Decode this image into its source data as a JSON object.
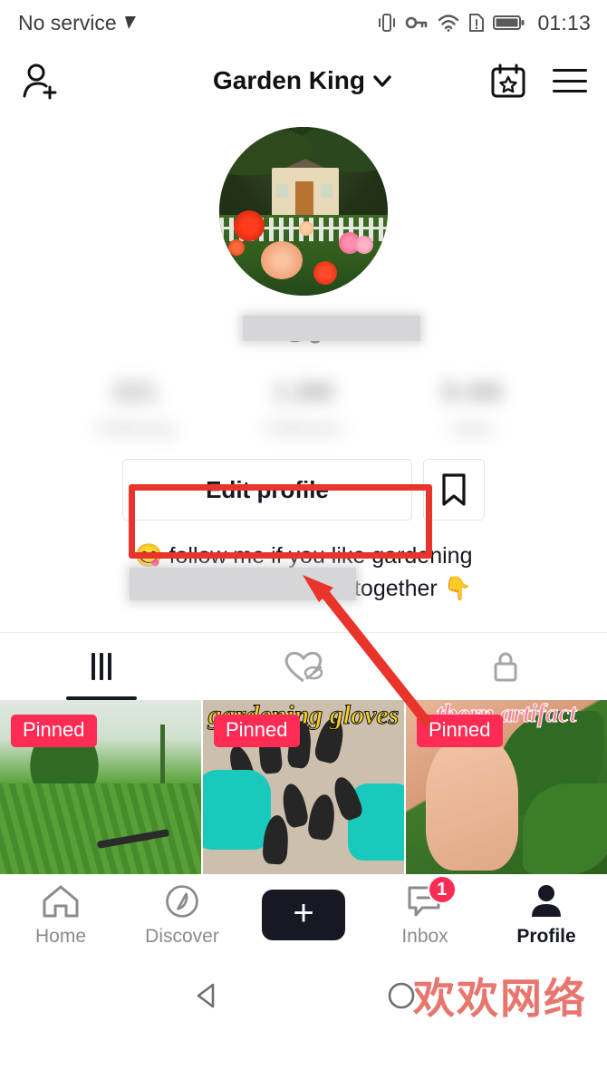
{
  "status_bar": {
    "carrier": "No service",
    "time": "01:13",
    "icons": [
      "signal-off-icon",
      "vibrate-icon",
      "key-icon",
      "wifi-icon",
      "sim-alert-icon",
      "battery-icon"
    ]
  },
  "header": {
    "title": "Garden King",
    "add_friends_icon": "person-add-icon",
    "dropdown_icon": "chevron-down-icon",
    "calendar_icon": "calendar-star-icon",
    "menu_icon": "hamburger-menu-icon"
  },
  "profile": {
    "avatar_alt": "garden-cottage-avatar",
    "username": "@g",
    "username_redacted": true,
    "stats": [
      {
        "value": "221",
        "label": "Following",
        "blurred": true
      },
      {
        "value": "1.8M",
        "label": "Followers",
        "blurred": true
      },
      {
        "value": "9.4M",
        "label": "Likes",
        "blurred": true
      }
    ],
    "edit_button": "Edit profile",
    "bookmark_icon": "bookmark-icon",
    "bio_line1": "😋 follow me if you like gardening",
    "bio_line2": "we can communicate together 👇"
  },
  "tabs": [
    {
      "name": "videos",
      "icon": "grid-icon",
      "active": true
    },
    {
      "name": "liked",
      "icon": "heart-hidden-icon",
      "active": false
    },
    {
      "name": "private",
      "icon": "lock-icon",
      "active": false
    }
  ],
  "videos": [
    {
      "badge": "Pinned",
      "overlay_text": ""
    },
    {
      "badge": "Pinned",
      "overlay_text": "gardening gloves"
    },
    {
      "badge": "Pinned",
      "overlay_text": "thorn artifact"
    }
  ],
  "bottom_nav": [
    {
      "label": "Home",
      "icon": "home-icon",
      "active": false,
      "badge": ""
    },
    {
      "label": "Discover",
      "icon": "compass-icon",
      "active": false,
      "badge": ""
    },
    {
      "label": "",
      "icon": "create-plus-icon",
      "active": false,
      "badge": ""
    },
    {
      "label": "Inbox",
      "icon": "inbox-message-icon",
      "active": false,
      "badge": "1"
    },
    {
      "label": "Profile",
      "icon": "person-icon",
      "active": true,
      "badge": ""
    }
  ],
  "android_nav": {
    "back_icon": "back-triangle-icon",
    "home_icon": "home-circle-icon"
  },
  "watermark": "欢欢网络",
  "annotation": {
    "highlight_target": "edit-profile-button",
    "color": "#e8342b",
    "arrow": "arrow-pointing-to-edit-profile"
  },
  "colors": {
    "accent_pink": "#fe2c55",
    "accent_cyan": "#22dbee",
    "annotation_red": "#e8342b",
    "text_dark": "#161823",
    "text_gray": "#8a8b8f",
    "watermark_red": "#e8756e"
  }
}
